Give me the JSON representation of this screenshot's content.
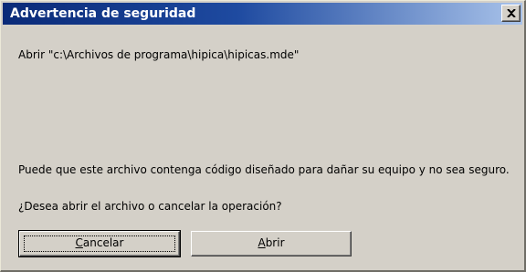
{
  "window": {
    "title": "Advertencia de seguridad",
    "close_icon": "close-icon"
  },
  "message": {
    "file_line": "Abrir \"c:\\Archivos de programa\\hipica\\hipicas.mde\"",
    "warning": "Puede que este archivo contenga código diseñado para dañar su equipo y no sea seguro.",
    "question": "¿Desea abrir el archivo o cancelar la operación?"
  },
  "buttons": {
    "cancel": {
      "accel": "C",
      "rest": "ancelar"
    },
    "open": {
      "accel": "A",
      "rest": "brir"
    }
  },
  "colors": {
    "titlebar_start": "#0a2a78",
    "titlebar_end": "#a9c3ea",
    "dialog_bg": "#d4d0c8"
  }
}
